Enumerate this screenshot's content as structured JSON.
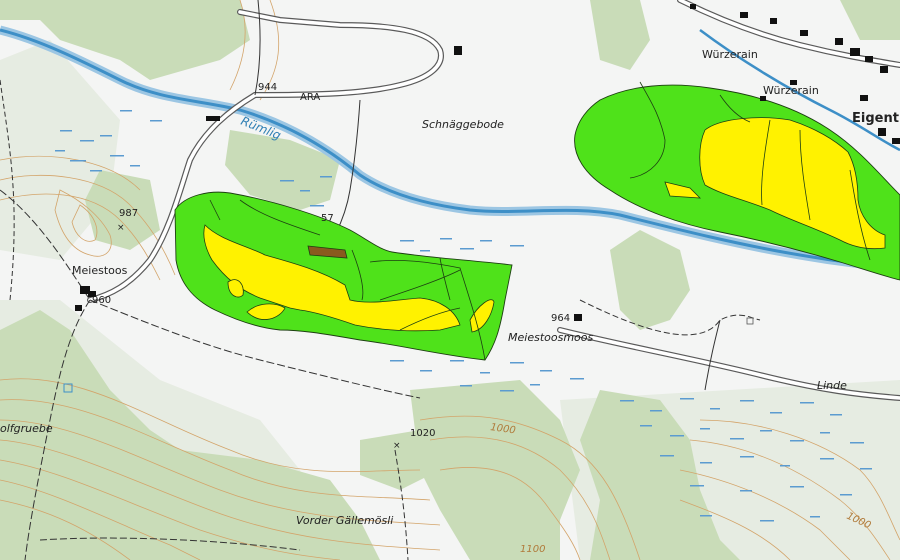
{
  "map": {
    "colors": {
      "background": "#f4f5f4",
      "forest": "#c9dcb8",
      "meadow_shade": "#e6ece2",
      "river": "#3d8fc7",
      "river_edge": "#9cc6e3",
      "marsh": "#5b9bd0",
      "contour": "#d3a46a",
      "road": "#ffffff",
      "road_edge": "#5a5a5a",
      "track": "#333333",
      "building": "#111111",
      "overlay_green": "#4fe21a",
      "overlay_yellow": "#fff200",
      "overlay_brown": "#8a5a1e",
      "overlay_stroke": "#1d3f12"
    },
    "labels": {
      "wurzerain_1": "Würzerain",
      "wurzerain_2": "Würzerain",
      "eigenthal": "Eigent",
      "schnaggebode": "Schnäggebode",
      "rumlig": "Rümlig",
      "ara": "ARA",
      "meiestoos": "Meiestoos",
      "meiestoosmoos": "Meiestoosmoos",
      "linde": "Linde",
      "wolfgruebe": "olfgruebe",
      "vorder_gallemosli": "Vorder Gällemösli"
    },
    "spot_heights": {
      "h944": "944",
      "h987": "987",
      "h960": "960",
      "h964": "964",
      "h1020": "1020",
      "h57": "57"
    },
    "contour_labels": {
      "c1000a": "1000",
      "c1000b": "1000",
      "c1100": "1100"
    }
  }
}
